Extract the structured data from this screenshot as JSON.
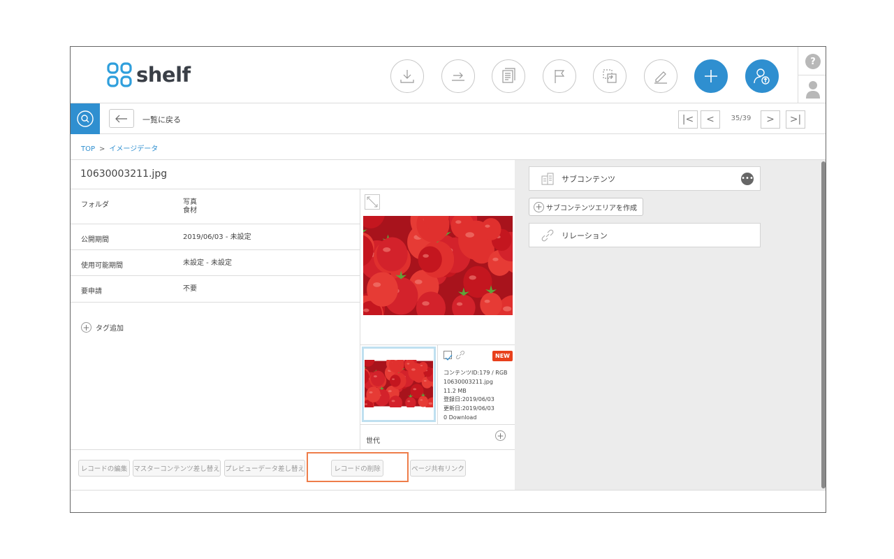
{
  "app": {
    "name": "shelf"
  },
  "nav": {
    "back_label": "一覧に戻る",
    "page_count": "35/39"
  },
  "breadcrumb": {
    "items": [
      "TOP",
      "イメージデータ"
    ],
    "separator": ">"
  },
  "record": {
    "title": "10630003211.jpg",
    "meta": [
      {
        "label": "フォルダ",
        "value_lines": [
          "写真",
          "食材"
        ]
      },
      {
        "label": "公開期間",
        "value_lines": [
          "2019/06/03 - 未設定"
        ]
      },
      {
        "label": "使用可能期間",
        "value_lines": [
          "未設定 - 未設定"
        ]
      },
      {
        "label": "要申請",
        "value_lines": [
          "不要"
        ]
      }
    ],
    "tag_add_label": "タグ追加"
  },
  "preview": {
    "badge": "NEW",
    "info": [
      "コンテンツID:179 / RGB",
      "10630003211.jpg",
      "11.2 MB",
      "登録日:2019/06/03",
      "更新日:2019/06/03",
      "0 Download"
    ],
    "generation_label": "世代"
  },
  "actions": {
    "edit": "レコードの編集",
    "replace_master": "マスターコンテンツ差し替え",
    "replace_preview": "プレビューデータ差し替え",
    "delete": "レコードの削除",
    "share_link": "ページ共有リンク"
  },
  "right": {
    "subcontents_label": "サブコンテンツ",
    "create_sub_label": "サブコンテンツエリアを作成",
    "relation_label": "リレーション"
  },
  "header_tools": [
    "download-icon",
    "export-icon",
    "document-icon",
    "flag-icon",
    "move-icon",
    "edit-icon",
    "plus-icon",
    "user-upload-icon"
  ],
  "colors": {
    "accent": "#2f8fd0",
    "highlight": "#ee7d4a",
    "new_badge": "#e8401c",
    "panel": "#ececec"
  }
}
